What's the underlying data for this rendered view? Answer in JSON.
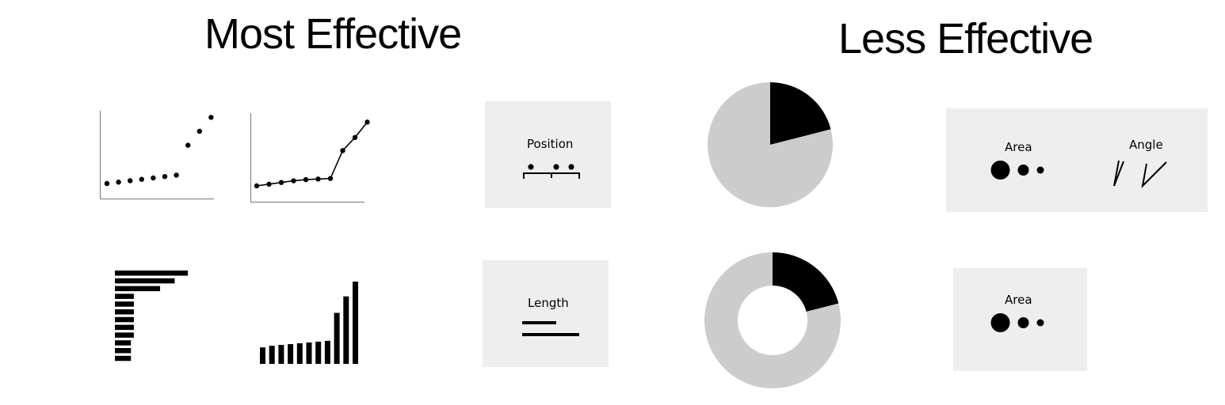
{
  "headings": {
    "left": "Most Effective",
    "right": "Less Effective"
  },
  "panels": {
    "position": "Position",
    "length": "Length",
    "area_top": "Area",
    "angle": "Angle",
    "area_bottom": "Area"
  },
  "colors": {
    "ink": "#000000",
    "panel_bg": "#eeeeee",
    "pie_rest": "#cccccc",
    "axis": "#777777"
  },
  "chart_data": [
    {
      "type": "scatter",
      "x": [
        1,
        2,
        3,
        4,
        5,
        6,
        7,
        8,
        9,
        10
      ],
      "y": [
        1,
        1.2,
        1.4,
        1.6,
        1.8,
        2,
        2.2,
        6.5,
        8.5,
        10.5
      ]
    },
    {
      "type": "line",
      "x": [
        1,
        2,
        3,
        4,
        5,
        6,
        7,
        8,
        9,
        10
      ],
      "y": [
        1,
        1.3,
        1.6,
        1.9,
        2.1,
        2.2,
        2.3,
        7.2,
        9.5,
        12.2
      ]
    },
    {
      "type": "bar",
      "orientation": "horizontal",
      "values": [
        10,
        8.2,
        6.2,
        2.6,
        2.6,
        2.6,
        2.6,
        2.6,
        2.6,
        2.2,
        2.2,
        2.2
      ]
    },
    {
      "type": "bar",
      "orientation": "vertical",
      "values": [
        2,
        2.2,
        2.3,
        2.4,
        2.5,
        2.6,
        2.7,
        2.8,
        6.2,
        8.2,
        10
      ]
    },
    {
      "type": "pie",
      "values": [
        21,
        79
      ]
    },
    {
      "type": "pie",
      "donut": true,
      "values": [
        21,
        79
      ]
    }
  ]
}
